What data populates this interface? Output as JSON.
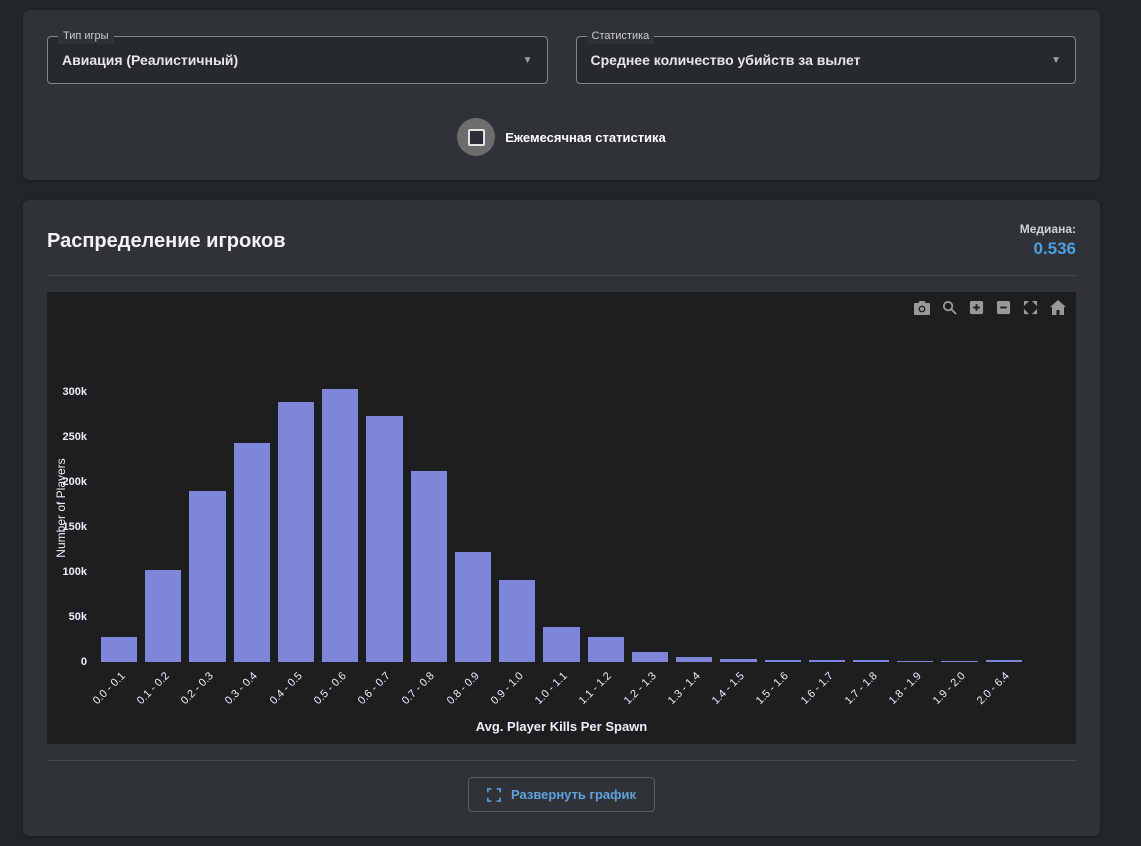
{
  "theme": {
    "accent_blue": "#4a9fe3",
    "bar_color": "#7d86d8",
    "panel_bg": "#2f3338",
    "chart_bg": "#1d1e20"
  },
  "filters": {
    "game_type": {
      "label": "Тип игры",
      "value": "Авиация (Реалистичный)"
    },
    "statistic": {
      "label": "Статистика",
      "value": "Среднее количество убийств за вылет"
    },
    "monthly_checkbox": {
      "label": "Ежемесячная статистика",
      "checked": false
    }
  },
  "distribution": {
    "title": "Распределение игроков",
    "median_label": "Медиана:",
    "median_value": "0.536",
    "expand_button_label": "Развернуть график",
    "modebar": [
      "camera",
      "zoom",
      "zoom-in",
      "zoom-out",
      "autoscale",
      "home"
    ]
  },
  "chart_data": {
    "type": "bar",
    "title": "",
    "categories": [
      "0.0 - 0.1",
      "0.1 - 0.2",
      "0.2 - 0.3",
      "0.3 - 0.4",
      "0.4 - 0.5",
      "0.5 - 0.6",
      "0.6 - 0.7",
      "0.7 - 0.8",
      "0.8 - 0.9",
      "0.9 - 1.0",
      "1.0 - 1.1",
      "1.1 - 1.2",
      "1.2 - 1.3",
      "1.3 - 1.4",
      "1.4 - 1.5",
      "1.5 - 1.6",
      "1.6 - 1.7",
      "1.7 - 1.8",
      "1.8 - 1.9",
      "1.9 - 2.0",
      "2.0 - 6.4"
    ],
    "values": [
      28000,
      102000,
      190000,
      243000,
      289000,
      303000,
      273000,
      212000,
      122000,
      91000,
      39000,
      28000,
      11000,
      6000,
      3500,
      2500,
      2200,
      1800,
      1500,
      1200,
      2000
    ],
    "xlabel": "Avg. Player Kills Per Spawn",
    "ylabel": "Number of Players",
    "ylim": [
      0,
      342000
    ],
    "yticks": [
      0,
      50000,
      100000,
      150000,
      200000,
      250000,
      300000
    ],
    "ytick_labels": [
      "0",
      "50k",
      "100k",
      "150k",
      "200k",
      "250k",
      "300k"
    ],
    "bar_color": "#7d86d8",
    "grid": false,
    "legend": false
  }
}
